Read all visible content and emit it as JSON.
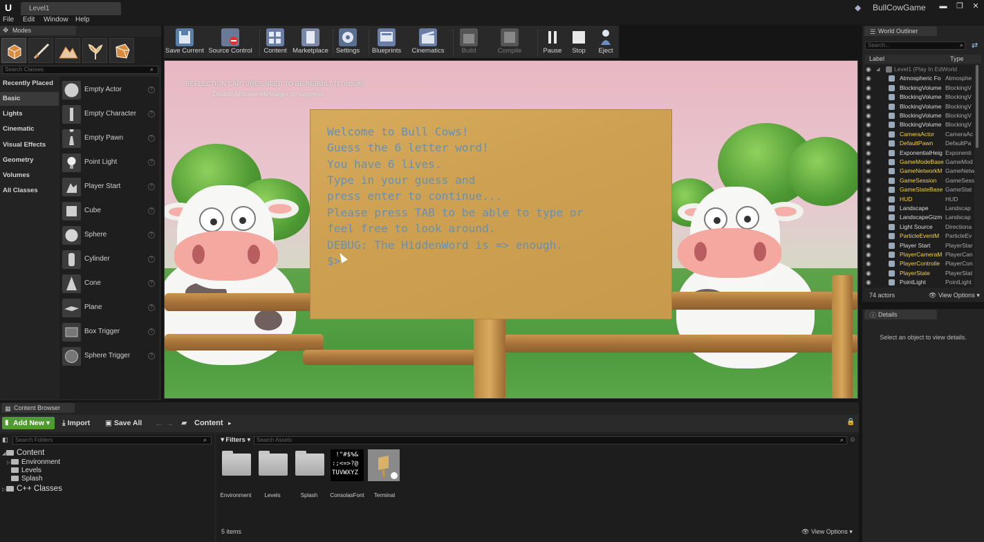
{
  "window": {
    "level_tab": "Level1",
    "project_name": "BullCowGame",
    "minimize": "▬",
    "maximize": "❐",
    "close": "✕"
  },
  "menu": [
    "File",
    "Edit",
    "Window",
    "Help"
  ],
  "modes": {
    "tab_label": "Modes",
    "search_placeholder": "Search Classes",
    "categories": [
      "Recently Placed",
      "Basic",
      "Lights",
      "Cinematic",
      "Visual Effects",
      "Geometry",
      "Volumes",
      "All Classes"
    ],
    "active_category": "Basic",
    "items": [
      "Empty Actor",
      "Empty Character",
      "Empty Pawn",
      "Point Light",
      "Player Start",
      "Cube",
      "Sphere",
      "Cylinder",
      "Cone",
      "Plane",
      "Box Trigger",
      "Sphere Trigger"
    ]
  },
  "toolbar": {
    "buttons": [
      "Save Current",
      "Source Control",
      "Content",
      "Marketplace",
      "Settings",
      "Blueprints",
      "Cinematics",
      "Build",
      "Compile",
      "Pause",
      "Stop",
      "Eject"
    ]
  },
  "viewport": {
    "warning_line1": "REFLECTION CAPTURES NEED TO BE REBUILT (1 unbuilt)",
    "warning_line2": "'DisableAllScreenMessages' to suppress",
    "terminal_lines": [
      "Welcome to Bull Cows!",
      "Guess the 6 letter word!",
      "You have 6 lives.",
      "Type in your guess and",
      "press enter to continue...",
      "Please press TAB to be able to type or",
      "feel free to look around.",
      "DEBUG: The HiddenWord is => enough.",
      "$>"
    ],
    "terminal_color": "#6590b3"
  },
  "outliner": {
    "tab_label": "World Outliner",
    "search_placeholder": "Search...",
    "col_label": "Label",
    "col_type": "Type",
    "root": "Level1 (Play In EdWorld",
    "rows": [
      {
        "label": "Atmospheric Fo",
        "type": "Atmosphe",
        "yellow": false
      },
      {
        "label": "BlockingVolume",
        "type": "BlockingV",
        "yellow": false
      },
      {
        "label": "BlockingVolume",
        "type": "BlockingV",
        "yellow": false
      },
      {
        "label": "BlockingVolume",
        "type": "BlockingV",
        "yellow": false
      },
      {
        "label": "BlockingVolume",
        "type": "BlockingV",
        "yellow": false
      },
      {
        "label": "BlockingVolume",
        "type": "BlockingV",
        "yellow": false
      },
      {
        "label": "CameraActor",
        "type": "CameraAc",
        "yellow": true
      },
      {
        "label": "DefaultPawn",
        "type": "DefaultPa",
        "yellow": true
      },
      {
        "label": "ExponentialHeig",
        "type": "Exponenti",
        "yellow": false
      },
      {
        "label": "GameModeBase",
        "type": "GameMod",
        "yellow": true
      },
      {
        "label": "GameNetworkM",
        "type": "GameNetw",
        "yellow": true
      },
      {
        "label": "GameSession",
        "type": "GameSess",
        "yellow": true
      },
      {
        "label": "GameStateBase",
        "type": "GameStat",
        "yellow": true
      },
      {
        "label": "HUD",
        "type": "HUD",
        "yellow": true
      },
      {
        "label": "Landscape",
        "type": "Landscap",
        "yellow": false
      },
      {
        "label": "LandscapeGizm",
        "type": "Landscap",
        "yellow": false
      },
      {
        "label": "Light Source",
        "type": "Directiona",
        "yellow": false
      },
      {
        "label": "ParticleEventM",
        "type": "ParticleEv",
        "yellow": true
      },
      {
        "label": "Player Start",
        "type": "PlayerStar",
        "yellow": false
      },
      {
        "label": "PlayerCameraM",
        "type": "PlayerCan",
        "yellow": true
      },
      {
        "label": "PlayerControlle",
        "type": "PlayerCon",
        "yellow": true
      },
      {
        "label": "PlayerState",
        "type": "PlayerStat",
        "yellow": true
      },
      {
        "label": "PointLight",
        "type": "PointLight",
        "yellow": false
      }
    ],
    "actor_count": "74 actors",
    "view_options": "View Options"
  },
  "details": {
    "tab_label": "Details",
    "message": "Select an object to view details."
  },
  "content_browser": {
    "tab_label": "Content Browser",
    "add_new": "Add New",
    "import": "Import",
    "save_all": "Save All",
    "path": "Content",
    "folders_search_placeholder": "Search Folders",
    "tree": [
      "Content",
      "Environment",
      "Levels",
      "Splash",
      "C++ Classes"
    ],
    "filters": "Filters",
    "assets_search_placeholder": "Search Assets",
    "assets": [
      "Environment",
      "Levels",
      "Splash",
      "ConsolasFont",
      "Terminal"
    ],
    "font_thumb_text": " !\"#$%&\n:;<=>?@\nTUVWXYZ",
    "items_count": "5 items",
    "view_options": "View Options"
  }
}
